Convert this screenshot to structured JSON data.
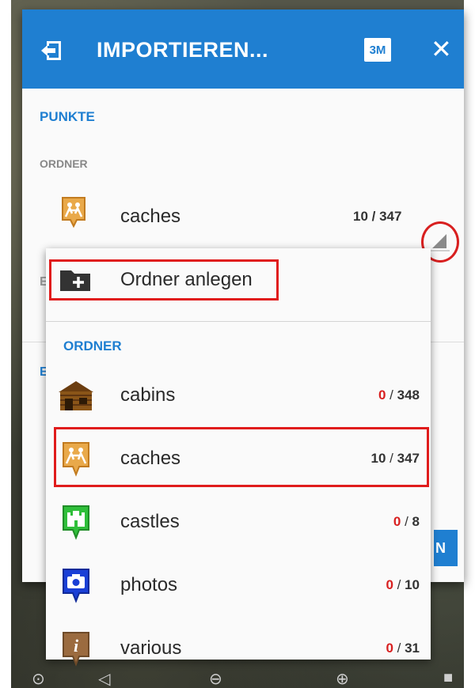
{
  "dialog": {
    "title": "IMPORTIEREN...",
    "sm_icon_label": "3M",
    "close_label": "✕",
    "section_title": "PUNKTE",
    "folder_label": "ORDNER",
    "selected_folder": {
      "name": "caches",
      "count": "10 / 347",
      "icon": "geocache-icon"
    },
    "partial_letter_1": "E",
    "partial_letter_2": "E",
    "blue_button_fragment": "N"
  },
  "popup": {
    "new_folder_label": "Ordner anlegen",
    "section_title": "ORDNER",
    "items": [
      {
        "name": "cabins",
        "count_left": "0",
        "count_right": "348",
        "zero": true,
        "icon": "cabin-icon"
      },
      {
        "name": "caches",
        "count_left": "10",
        "count_right": "347",
        "zero": false,
        "icon": "geocache-icon"
      },
      {
        "name": "castles",
        "count_left": "0",
        "count_right": "8",
        "zero": true,
        "icon": "castle-icon"
      },
      {
        "name": "photos",
        "count_left": "0",
        "count_right": "10",
        "zero": true,
        "icon": "camera-icon"
      },
      {
        "name": "various",
        "count_left": "0",
        "count_right": "31",
        "zero": true,
        "icon": "info-icon"
      }
    ]
  },
  "colors": {
    "accent": "#1f7fd1",
    "highlight": "#e01c1c",
    "zero_count": "#d81f1f"
  }
}
